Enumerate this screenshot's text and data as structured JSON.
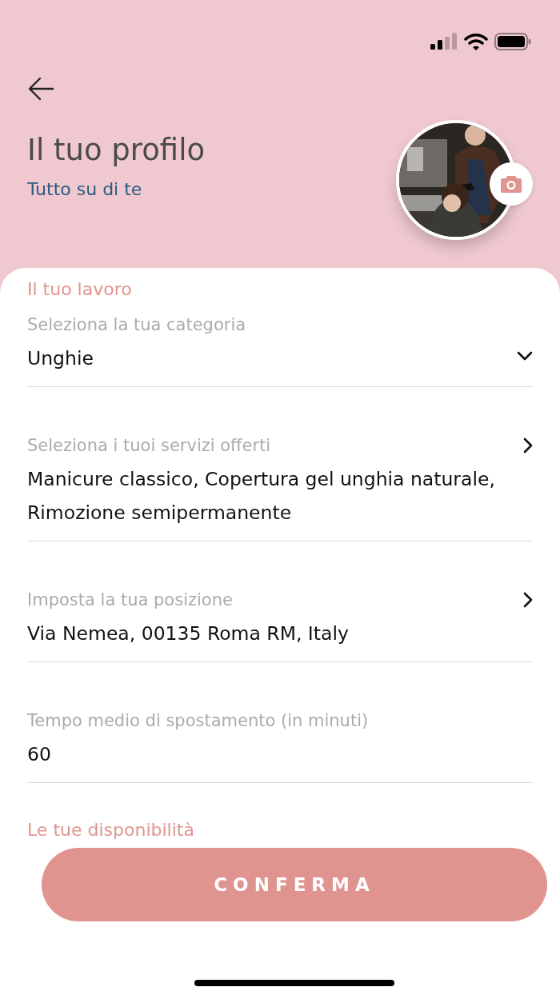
{
  "header": {
    "title": "Il tuo profilo",
    "subtitle": "Tutto su di te"
  },
  "section": "Il tuo lavoro",
  "fields": [
    {
      "kind": "select",
      "label": "Seleziona la tua categoria",
      "value": "Unghie"
    },
    {
      "kind": "link",
      "label": "Seleziona i tuoi servizi offerti",
      "value": "Manicure classico, Copertura gel unghia naturale, Rimozione semipermanente"
    },
    {
      "kind": "link",
      "label": "Imposta la tua posizione",
      "value": "Via Nemea, 00135 Roma RM, Italy"
    },
    {
      "kind": "text",
      "label": "Tempo medio di spostamento (in minuti)",
      "value": "60"
    }
  ],
  "next_section": "Le tue disponibilità",
  "confirm_button": "CONFERMA"
}
